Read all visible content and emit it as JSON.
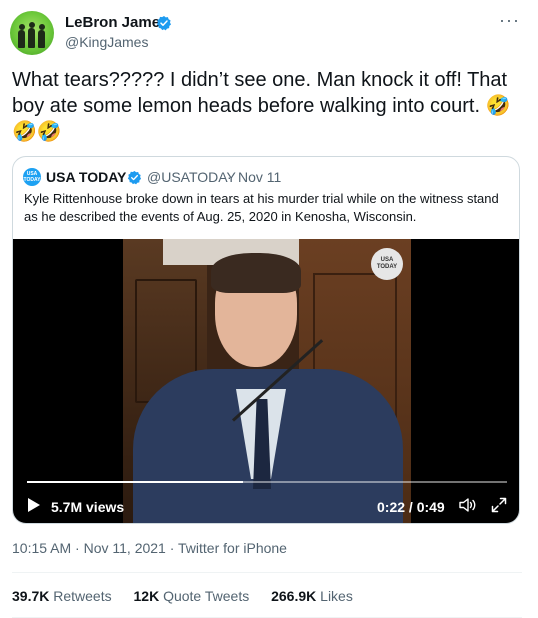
{
  "author": {
    "name": "LeBron James",
    "handle": "@KingJames",
    "avatar_icon": "avatar-image",
    "verified_icon": "verified-badge-icon"
  },
  "tweet": {
    "text": "What tears????? I didn’t see one. Man knock it off! That boy ate some lemon heads before walking into court. 🤣🤣🤣",
    "timestamp": "10:15 AM · Nov 11, 2021 · Twitter for iPhone"
  },
  "quote": {
    "name": "USA TODAY",
    "handle": "@USATODAY",
    "separator": "·",
    "date": "Nov 11",
    "avatar_text": "USA TODAY",
    "text": "Kyle Rittenhouse broke down in tears at his murder trial while on the witness stand as he described the events of Aug. 25, 2020 in Kenosha, Wisconsin.",
    "video": {
      "views": "5.7M views",
      "time": "0:22 / 0:49",
      "progress": 0.449,
      "watermark": "USA TODAY"
    }
  },
  "stats": {
    "retweets_count": "39.7K",
    "retweets_label": "Retweets",
    "quotes_count": "12K",
    "quotes_label": "Quote Tweets",
    "likes_count": "266.9K",
    "likes_label": "Likes"
  },
  "colors": {
    "verified": "#1d9bf0",
    "text_primary": "#0f1419",
    "text_secondary": "#536471",
    "border": "#cfd9de"
  }
}
